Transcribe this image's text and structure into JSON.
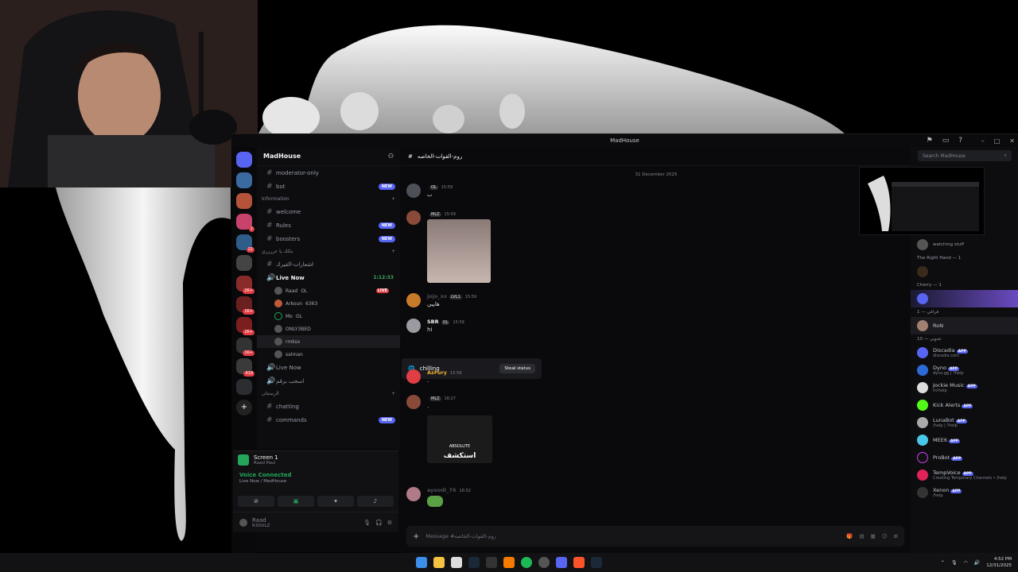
{
  "window": {
    "title": "MadHouse"
  },
  "server": {
    "name": "MadHouse"
  },
  "channels_top": [
    {
      "name": "moderator-only",
      "badge": ""
    },
    {
      "name": "bot",
      "badge": "NEW"
    }
  ],
  "information": {
    "label": "Information",
    "channels": [
      {
        "name": "welcome",
        "badge": ""
      },
      {
        "name": "Rules",
        "badge": "NEW"
      },
      {
        "name": "boosters",
        "badge": "NEW"
      }
    ]
  },
  "voice_category": {
    "label": "بثكك يا عرررري"
  },
  "voice_channels": [
    {
      "name": "اشعارات-القيرك",
      "timer": ""
    },
    {
      "name": "Live Now",
      "timer": "1:12:33"
    }
  ],
  "voice_users": [
    {
      "name": "Raad",
      "tag": "OL",
      "live": "LIVE"
    },
    {
      "name": "Arkoun",
      "tag": "6363",
      "live": ""
    },
    {
      "name": "Mo",
      "tag": "OL",
      "live": ""
    },
    {
      "name": "ONLY3BED",
      "tag": "",
      "live": ""
    },
    {
      "name": "rmksx",
      "tag": "",
      "live": ""
    },
    {
      "name": "salman",
      "tag": "",
      "live": ""
    }
  ],
  "voice_channels_2": [
    {
      "name": "Live Now"
    },
    {
      "name": "اسحب برقم"
    }
  ],
  "category_3": {
    "label": "الرستتان",
    "channels": [
      {
        "name": "chatting",
        "badge": ""
      },
      {
        "name": "commands",
        "badge": "NEW"
      }
    ]
  },
  "panel": {
    "screen_title": "Screen 1",
    "screen_sub": "Raad Paul",
    "voice_connected": "Voice Connected",
    "voice_sub": "Live Now / MadHouse",
    "user_name": "Raad",
    "user_tag": "R3DULZ"
  },
  "chat": {
    "channel_title": "روم-القوات-الخاصه",
    "date_divider": "31 December 2025",
    "messages": [
      {
        "name": "",
        "tag": "OL",
        "time": "15:59",
        "text": "ب"
      },
      {
        "name": "",
        "tag": "MLZ",
        "time": "15:59",
        "text": ""
      },
      {
        "name": "jojo_xx",
        "tag": "LVL1",
        "time": "15:59",
        "text": "هاييي"
      },
      {
        "name": "SBR",
        "tag": "OL",
        "time": "15:59",
        "text": "hi"
      },
      {
        "name": "AzFury",
        "tag": "",
        "time": "15:59",
        "text": "."
      },
      {
        "name": "",
        "tag": "MLZ",
        "time": "16:27",
        "text": "."
      },
      {
        "name": "ayoodi_76",
        "tag": "",
        "time": "16:52",
        "text": ""
      }
    ],
    "popup_status": "chilling",
    "popup_button": "Steal status",
    "image_caption_top": "ABSOLUTE",
    "image_caption_bottom": "استكشف",
    "composer_placeholder": "Message #روم-القوات-الخاصه"
  },
  "members": {
    "search_placeholder": "Search MadHouse",
    "rows_top": [
      {
        "name": "",
        "activity": "watching stuff"
      }
    ],
    "sections": [
      {
        "label": "The Right Hand — 1"
      },
      {
        "label": "Cherry — 1"
      },
      {
        "label": "فراغي — 1"
      },
      {
        "label": "عدويي — 10"
      }
    ],
    "named": [
      {
        "name": "RoN",
        "activity": ""
      }
    ],
    "bots": [
      {
        "name": "Discadia",
        "app": "APP",
        "sub": "discadia.com"
      },
      {
        "name": "Dyno",
        "app": "APP",
        "sub": "dyno.gg | ?help"
      },
      {
        "name": "Jockie Music",
        "app": "APP",
        "sub": "m!help"
      },
      {
        "name": "Kick Alerts",
        "app": "APP",
        "sub": ""
      },
      {
        "name": "LunaBot",
        "app": "APP",
        "sub": "/help | ?help"
      },
      {
        "name": "MEE6",
        "app": "APP",
        "sub": ""
      },
      {
        "name": "ProBot",
        "app": "APP",
        "sub": ""
      },
      {
        "name": "TempVoice",
        "app": "APP",
        "sub": "Creating Temporary Channels • /help"
      },
      {
        "name": "Xenon",
        "app": "APP",
        "sub": "/help"
      }
    ]
  },
  "guild_badges": [
    "2",
    "22",
    "2K+",
    "1K+",
    "2K+",
    "1K+",
    "419"
  ],
  "taskbar": {
    "time": "4:52 PM",
    "date": "12/31/2025"
  },
  "colors": {
    "accent": "#5865f2",
    "online": "#23a55a",
    "live": "#e03d44"
  }
}
